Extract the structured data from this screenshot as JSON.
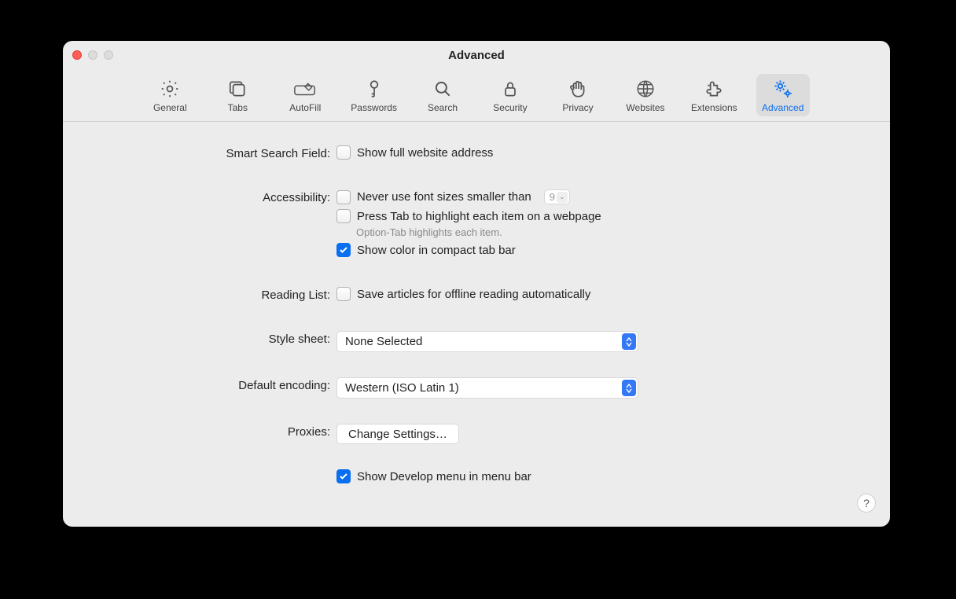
{
  "window": {
    "title": "Advanced"
  },
  "tabs": [
    {
      "id": "general",
      "label": "General"
    },
    {
      "id": "tabs",
      "label": "Tabs"
    },
    {
      "id": "autofill",
      "label": "AutoFill"
    },
    {
      "id": "passwords",
      "label": "Passwords"
    },
    {
      "id": "search",
      "label": "Search"
    },
    {
      "id": "security",
      "label": "Security"
    },
    {
      "id": "privacy",
      "label": "Privacy"
    },
    {
      "id": "websites",
      "label": "Websites"
    },
    {
      "id": "extensions",
      "label": "Extensions"
    },
    {
      "id": "advanced",
      "label": "Advanced"
    }
  ],
  "form": {
    "smart_search": {
      "label": "Smart Search Field:",
      "show_full_address": {
        "text": "Show full website address",
        "checked": false
      }
    },
    "accessibility": {
      "label": "Accessibility:",
      "min_font": {
        "text": "Never use font sizes smaller than",
        "checked": false,
        "value": "9"
      },
      "press_tab": {
        "text": "Press Tab to highlight each item on a webpage",
        "checked": false
      },
      "hint": "Option-Tab highlights each item.",
      "show_color": {
        "text": "Show color in compact tab bar",
        "checked": true
      }
    },
    "reading_list": {
      "label": "Reading List:",
      "save_offline": {
        "text": "Save articles for offline reading automatically",
        "checked": false
      }
    },
    "style_sheet": {
      "label": "Style sheet:",
      "value": "None Selected"
    },
    "encoding": {
      "label": "Default encoding:",
      "value": "Western (ISO Latin 1)"
    },
    "proxies": {
      "label": "Proxies:",
      "button": "Change Settings…"
    },
    "develop": {
      "text": "Show Develop menu in menu bar",
      "checked": true
    }
  },
  "help": "?"
}
